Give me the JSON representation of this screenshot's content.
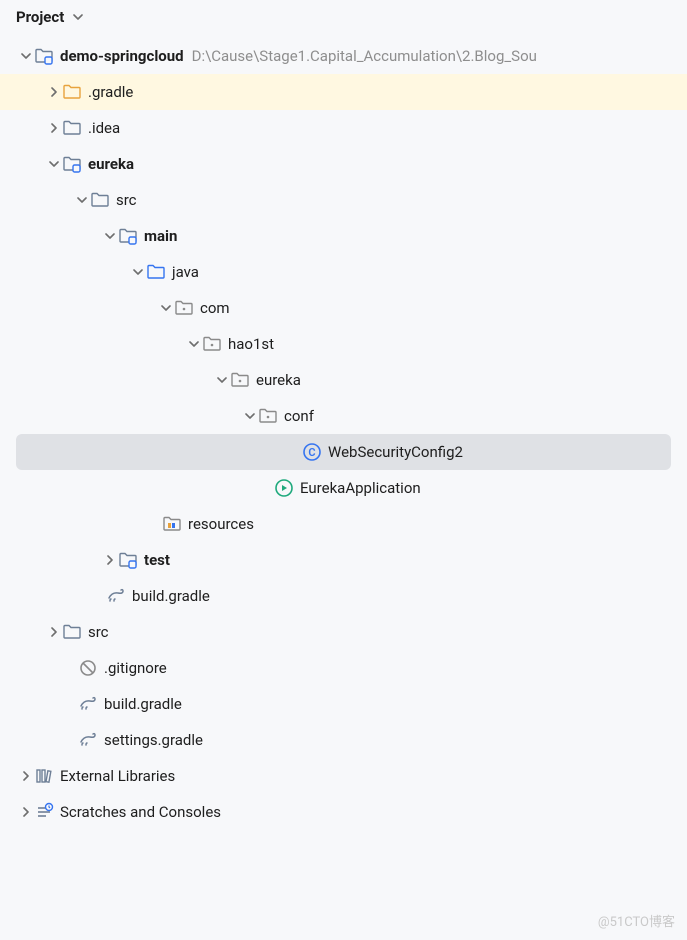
{
  "header": {
    "title": "Project"
  },
  "watermark": "@51CTO博客",
  "tree": {
    "root": {
      "name": "demo-springcloud",
      "path": "D:\\Cause\\Stage1.Capital_Accumulation\\2.Blog_Sou"
    },
    "items": [
      {
        "label": ".gradle"
      },
      {
        "label": ".idea"
      },
      {
        "label": "eureka"
      },
      {
        "label": "src"
      },
      {
        "label": "main"
      },
      {
        "label": "java"
      },
      {
        "label": "com"
      },
      {
        "label": "hao1st"
      },
      {
        "label": "eureka"
      },
      {
        "label": "conf"
      },
      {
        "label": "WebSecurityConfig2"
      },
      {
        "label": "EurekaApplication"
      },
      {
        "label": "resources"
      },
      {
        "label": "test"
      },
      {
        "label": "build.gradle"
      },
      {
        "label": "src"
      },
      {
        "label": ".gitignore"
      },
      {
        "label": "build.gradle"
      },
      {
        "label": "settings.gradle"
      },
      {
        "label": "External Libraries"
      },
      {
        "label": "Scratches and Consoles"
      }
    ]
  }
}
